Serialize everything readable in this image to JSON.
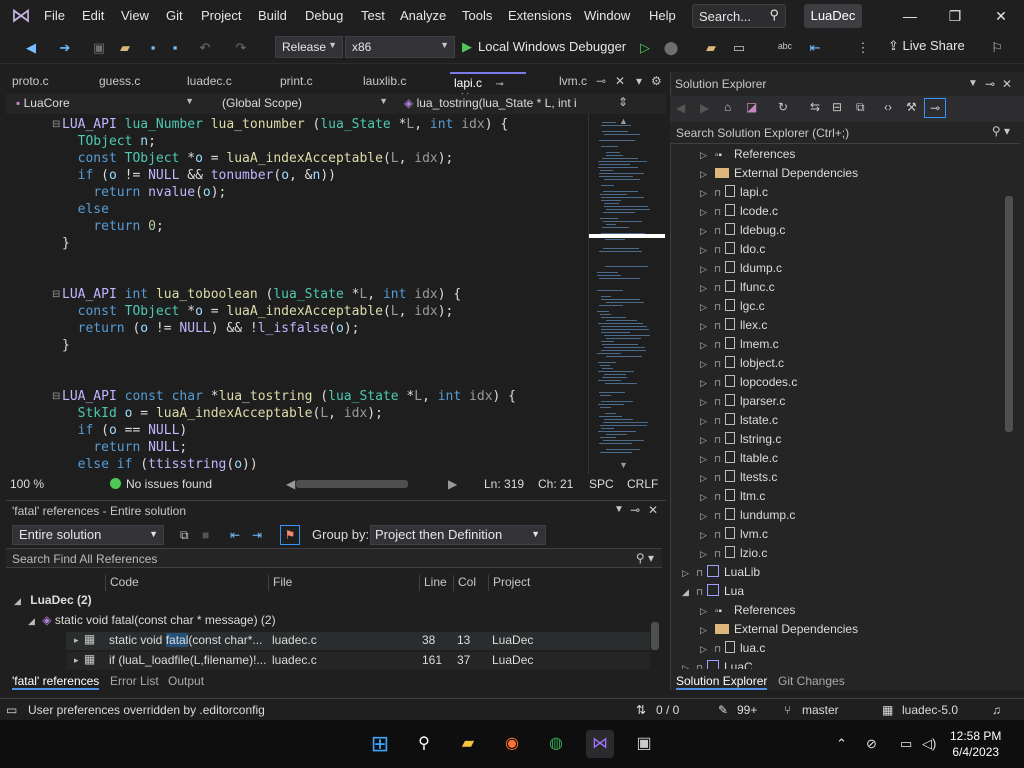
{
  "menu": {
    "items": [
      "File",
      "Edit",
      "View",
      "Git",
      "Project",
      "Build",
      "Debug",
      "Test",
      "Analyze",
      "Tools",
      "Extensions",
      "Window",
      "Help"
    ],
    "search_label": "Search...",
    "solution_name": "LuaDec"
  },
  "toolbar": {
    "configuration": "Release",
    "platform": "x86",
    "debugger": "Local Windows Debugger",
    "live_share": "Live Share"
  },
  "doc_tabs": [
    {
      "label": "proto.c"
    },
    {
      "label": "guess.c"
    },
    {
      "label": "luadec.c"
    },
    {
      "label": "print.c"
    },
    {
      "label": "lauxlib.c"
    },
    {
      "label": "lapi.c",
      "active": true
    },
    {
      "label": "lvm.c"
    }
  ],
  "nav": {
    "project": "LuaCore",
    "scope": "(Global Scope)",
    "member": "lua_tostring(lua_State * L, int i"
  },
  "code": [
    "LUA_API lua_Number lua_tonumber (lua_State *L, int idx) {",
    "  TObject n;",
    "  const TObject *o = luaA_indexAcceptable(L, idx);",
    "  if (o != NULL && tonumber(o, &n))",
    "    return nvalue(o);",
    "  else",
    "    return 0;",
    "}",
    "",
    "",
    "LUA_API int lua_toboolean (lua_State *L, int idx) {",
    "  const TObject *o = luaA_indexAcceptable(L, idx);",
    "  return (o != NULL) && !l_isfalse(o);",
    "}",
    "",
    "",
    "LUA_API const char *lua_tostring (lua_State *L, int idx) {",
    "  StkId o = luaA_indexAcceptable(L, idx);",
    "  if (o == NULL)",
    "    return NULL;",
    "  else if (ttisstring(o))"
  ],
  "editor_status": {
    "zoom": "100 %",
    "issues": "No issues found",
    "line": "Ln: 319",
    "col": "Ch: 21",
    "whitespace": "SPC",
    "eol": "CRLF"
  },
  "references": {
    "title": "'fatal' references - Entire solution",
    "scope": "Entire solution",
    "group_by_label": "Group by:",
    "group_by_value": "Project then Definition",
    "search_placeholder": "Search Find All References",
    "columns": [
      "Code",
      "File",
      "Line",
      "Col",
      "Project"
    ],
    "group": "LuaDec (2)",
    "definition": "static void fatal(const char * message)  (2)",
    "rows": [
      {
        "code_pre": "static void ",
        "code_hl": "fatal",
        "code_post": "(const char*...",
        "file": "luadec.c",
        "line": "38",
        "col": "13",
        "project": "LuaDec"
      },
      {
        "code_pre": "if (luaL_loadfile(L,filename)!...",
        "code_hl": "",
        "code_post": "",
        "file": "luadec.c",
        "line": "161",
        "col": "37",
        "project": "LuaDec"
      }
    ],
    "bottom_tabs": [
      "'fatal' references",
      "Error List",
      "Output"
    ]
  },
  "solution_explorer": {
    "title": "Solution Explorer",
    "search_placeholder": "Search Solution Explorer (Ctrl+;)",
    "items": [
      {
        "label": "References",
        "kind": "refs",
        "depth": 2
      },
      {
        "label": "External Dependencies",
        "kind": "folder",
        "depth": 2
      },
      {
        "label": "lapi.c",
        "kind": "file",
        "depth": 2
      },
      {
        "label": "lcode.c",
        "kind": "file",
        "depth": 2
      },
      {
        "label": "ldebug.c",
        "kind": "file",
        "depth": 2
      },
      {
        "label": "ldo.c",
        "kind": "file",
        "depth": 2
      },
      {
        "label": "ldump.c",
        "kind": "file",
        "depth": 2
      },
      {
        "label": "lfunc.c",
        "kind": "file",
        "depth": 2
      },
      {
        "label": "lgc.c",
        "kind": "file",
        "depth": 2
      },
      {
        "label": "llex.c",
        "kind": "file",
        "depth": 2
      },
      {
        "label": "lmem.c",
        "kind": "file",
        "depth": 2
      },
      {
        "label": "lobject.c",
        "kind": "file",
        "depth": 2
      },
      {
        "label": "lopcodes.c",
        "kind": "file",
        "depth": 2
      },
      {
        "label": "lparser.c",
        "kind": "file",
        "depth": 2
      },
      {
        "label": "lstate.c",
        "kind": "file",
        "depth": 2
      },
      {
        "label": "lstring.c",
        "kind": "file",
        "depth": 2
      },
      {
        "label": "ltable.c",
        "kind": "file",
        "depth": 2
      },
      {
        "label": "ltests.c",
        "kind": "file",
        "depth": 2
      },
      {
        "label": "ltm.c",
        "kind": "file",
        "depth": 2
      },
      {
        "label": "lundump.c",
        "kind": "file",
        "depth": 2
      },
      {
        "label": "lvm.c",
        "kind": "file",
        "depth": 2
      },
      {
        "label": "lzio.c",
        "kind": "file",
        "depth": 2
      },
      {
        "label": "LuaLib",
        "kind": "project",
        "depth": 1
      },
      {
        "label": "Lua",
        "kind": "project",
        "depth": 1,
        "expanded": true
      },
      {
        "label": "References",
        "kind": "refs",
        "depth": 2
      },
      {
        "label": "External Dependencies",
        "kind": "folder",
        "depth": 2
      },
      {
        "label": "lua.c",
        "kind": "file",
        "depth": 2
      },
      {
        "label": "LuaC",
        "kind": "project",
        "depth": 1
      }
    ],
    "bottom_tabs": [
      "Solution Explorer",
      "Git Changes"
    ]
  },
  "statusbar": {
    "message": "User preferences overridden by .editorconfig",
    "sync": "0 / 0",
    "pending": "99+",
    "branch": "master",
    "repo": "luadec-5.0"
  },
  "taskbar": {
    "time": "12:58 PM",
    "date": "6/4/2023"
  },
  "colors": {
    "accent": "#7a7aea",
    "keyword": "#569cd6",
    "type": "#4ec9b0",
    "function": "#dcdcaa",
    "success": "#4ec955"
  }
}
